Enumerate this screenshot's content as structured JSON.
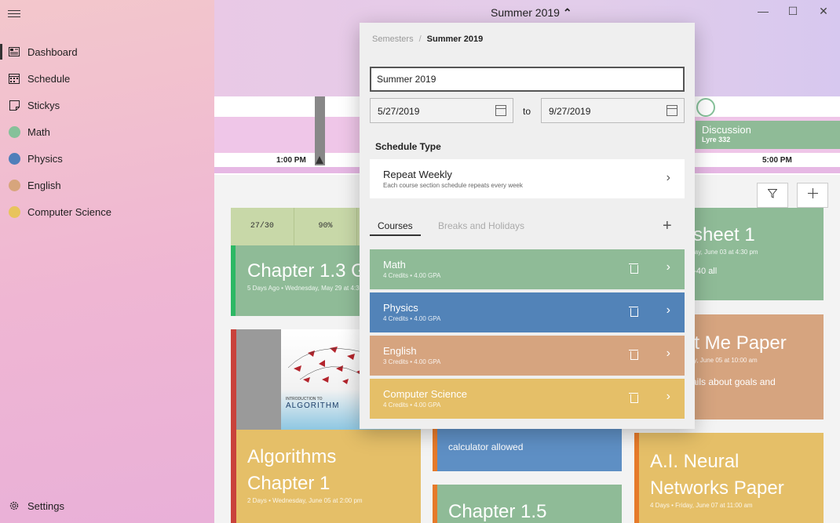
{
  "window": {
    "title": "Summer 2019",
    "title_chevron": "⌃",
    "minimize": "—",
    "maximize": "☐",
    "close": "✕"
  },
  "sidebar": {
    "items": [
      {
        "label": "Dashboard",
        "icon": "dashboard-icon"
      },
      {
        "label": "Schedule",
        "icon": "calendar-icon"
      },
      {
        "label": "Stickys",
        "icon": "sticky-note-icon"
      },
      {
        "label": "Math",
        "color": "#86c19a"
      },
      {
        "label": "Physics",
        "color": "#4f7fba"
      },
      {
        "label": "English",
        "color": "#d7a57c"
      },
      {
        "label": "Computer Science",
        "color": "#e8c45c"
      }
    ],
    "settings_label": "Settings"
  },
  "timeline": {
    "time_1": "1:00 PM",
    "time_2": "5:00 PM",
    "event": {
      "title": "Discussion",
      "location": "Lyre 332"
    }
  },
  "toolbar": {
    "filter_icon": "filter-icon",
    "add_icon": "plus-icon"
  },
  "cards": {
    "strip": [
      "27/30",
      "90%",
      ""
    ],
    "chapter13": {
      "title": "Chapter 1.3 G",
      "meta": "5 Days Ago • Wednesday, May 29 at 4:30 PM"
    },
    "worksheet": {
      "title": "ksheet 1",
      "meta": "Friday, June 03 at 4:30 pm",
      "body": "30-40 all"
    },
    "aboutme": {
      "title": "ut Me Paper",
      "meta": "sday, June 05 at 10:00 am",
      "body1": "etails about goals and",
      "body2": "d"
    },
    "algorithms": {
      "title1": "Algorithms",
      "title2": "Chapter 1",
      "meta": "2 Days • Wednesday, June 05 at 2:00 pm"
    },
    "book": {
      "intro": "INTRODUCTION TO",
      "title": "ALGORITHM"
    },
    "calculator": {
      "body": "calculator allowed"
    },
    "chapter15": {
      "title": "Chapter 1.5"
    },
    "neural": {
      "title1": "A.I. Neural",
      "title2": "Networks Paper",
      "meta": "4 Days • Friday, June 07 at 11:00 am"
    }
  },
  "popup": {
    "breadcrumb_root": "Semesters",
    "breadcrumb_sep": "/",
    "breadcrumb_current": "Summer 2019",
    "name_value": "Summer 2019",
    "start_date": "5/27/2019",
    "to_label": "to",
    "end_date": "9/27/2019",
    "schedule_type_label": "Schedule Type",
    "schedule": {
      "title": "Repeat Weekly",
      "subtitle": "Each course section schedule repeats every week"
    },
    "tabs": [
      "Courses",
      "Breaks and Holidays"
    ],
    "add": "+",
    "courses": [
      {
        "name": "Math",
        "detail": "4 Credits • 4.00 GPA",
        "color": "#8fbb97"
      },
      {
        "name": "Physics",
        "detail": "4 Credits • 4.00 GPA",
        "color": "#5283b8"
      },
      {
        "name": "English",
        "detail": "3 Credits • 4.00 GPA",
        "color": "#d6a47f"
      },
      {
        "name": "Computer Science",
        "detail": "4 Credits • 4.00 GPA",
        "color": "#e5bf68"
      }
    ]
  }
}
